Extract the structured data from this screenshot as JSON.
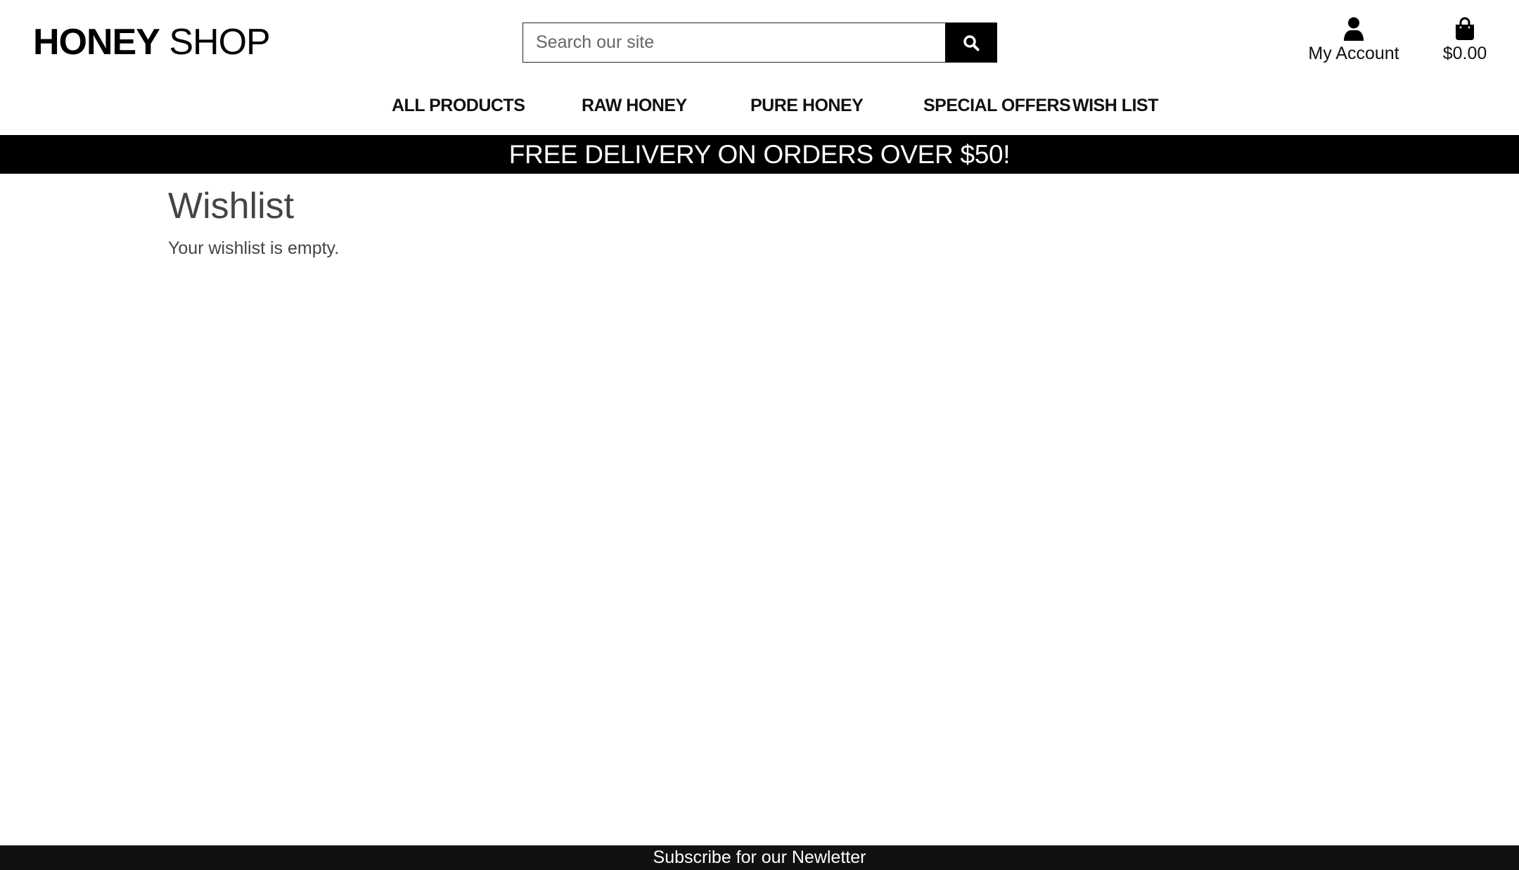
{
  "brand": {
    "name_bold": "HONEY",
    "name_light": "SHOP"
  },
  "search": {
    "placeholder": "Search our site",
    "button_icon": "search-icon"
  },
  "account": {
    "icon": "user-icon",
    "label": "My Account"
  },
  "bag": {
    "icon": "shopping-bag-icon",
    "total": "$0.00"
  },
  "nav": {
    "items": [
      {
        "label": "ALL PRODUCTS"
      },
      {
        "label": "RAW HONEY"
      },
      {
        "label": "PURE HONEY"
      },
      {
        "label": "SPECIAL OFFERS"
      },
      {
        "label": "WISH LIST"
      }
    ]
  },
  "banner": {
    "text": "FREE DELIVERY ON ORDERS OVER $50!"
  },
  "main": {
    "title": "Wishlist",
    "empty_message": "Your wishlist is empty."
  },
  "footer": {
    "newsletter_label": "Subscribe for our Newletter"
  },
  "colors": {
    "banner_bg": "#000000",
    "footer_bg": "#111111",
    "text_muted": "#444444"
  }
}
